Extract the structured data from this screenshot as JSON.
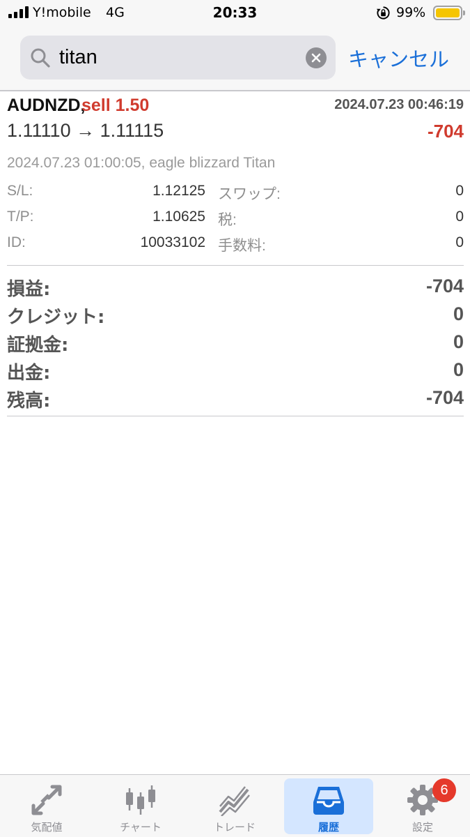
{
  "status_bar": {
    "carrier": "Y!mobile",
    "network": "4G",
    "time": "20:33",
    "battery_percent": "99%",
    "battery_level": 0.99,
    "icons": [
      "signal-icon",
      "orientation-lock-icon",
      "battery-icon"
    ]
  },
  "search": {
    "value": "titan",
    "cancel_label": "キャンセル"
  },
  "deal": {
    "symbol": "AUDNZD,",
    "side": "sell 1.50",
    "open_time": "2024.07.23 00:46:19",
    "prices": "1.11110 → 1.11115",
    "profit": "-704",
    "comment": "2024.07.23 01:00:05, eagle blizzard Titan",
    "details": [
      {
        "label": "S/L:",
        "value": "1.12125"
      },
      {
        "label": "T/P:",
        "value": "1.10625"
      },
      {
        "label": "ID:",
        "value": "10033102"
      },
      {
        "label": "スワップ:",
        "value": "0"
      },
      {
        "label": "税:",
        "value": "0"
      },
      {
        "label": "手数料:",
        "value": "0"
      }
    ]
  },
  "summary": [
    {
      "label": "損益:",
      "value": "-704"
    },
    {
      "label": "クレジット:",
      "value": "0"
    },
    {
      "label": "証拠金:",
      "value": "0"
    },
    {
      "label": "出金:",
      "value": "0"
    },
    {
      "label": "残高:",
      "value": "-704"
    }
  ],
  "tabs": [
    {
      "label": "気配値",
      "icon": "quotes-arrows-icon",
      "active": false
    },
    {
      "label": "チャート",
      "icon": "candlestick-chart-icon",
      "active": false
    },
    {
      "label": "トレード",
      "icon": "trade-chart-icon",
      "active": false
    },
    {
      "label": "履歴",
      "icon": "history-inbox-icon",
      "active": true
    },
    {
      "label": "設定",
      "icon": "gear-icon",
      "active": false
    }
  ],
  "settings_badge": "6",
  "colors": {
    "accent": "#1a6fd8",
    "loss": "#d03b2e",
    "active_tab_bg": "#d4e6ff",
    "badge": "#e5392b",
    "battery": "#f5c500"
  }
}
